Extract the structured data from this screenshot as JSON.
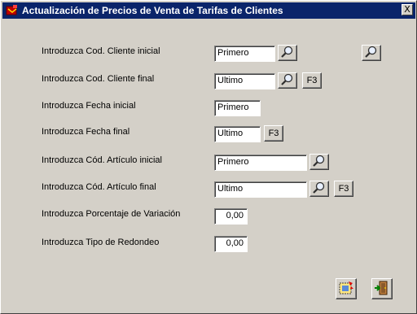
{
  "window": {
    "title": "Actualización de Precios de Venta de Tarifas de Clientes",
    "close_label": "X"
  },
  "rows": [
    {
      "label": "Introduzca Cod. Cliente inicial",
      "value": "Primero"
    },
    {
      "label": "Introduzca Cod. Cliente final",
      "value": "Ultimo",
      "key": "F3"
    },
    {
      "label": "Introduzca Fecha inicial",
      "value": "Primero"
    },
    {
      "label": "Introduzca Fecha final",
      "value": "Ultimo",
      "key": "F3"
    },
    {
      "label": "Introduzca Cód. Artículo inicial",
      "value": "Primero"
    },
    {
      "label": "Introduzca Cód. Artículo final",
      "value": "Ultimo",
      "key": "F3"
    },
    {
      "label": "Introduzca Porcentaje de Variación",
      "value": "0,00"
    },
    {
      "label": "Introduzca Tipo de Redondeo",
      "value": "0,00"
    }
  ],
  "icons": {
    "search": "magnifier-icon",
    "execute": "execute-icon",
    "exit": "exit-door-icon"
  },
  "colors": {
    "titlebar": "#0a246a",
    "window": "#d4d0c8"
  }
}
